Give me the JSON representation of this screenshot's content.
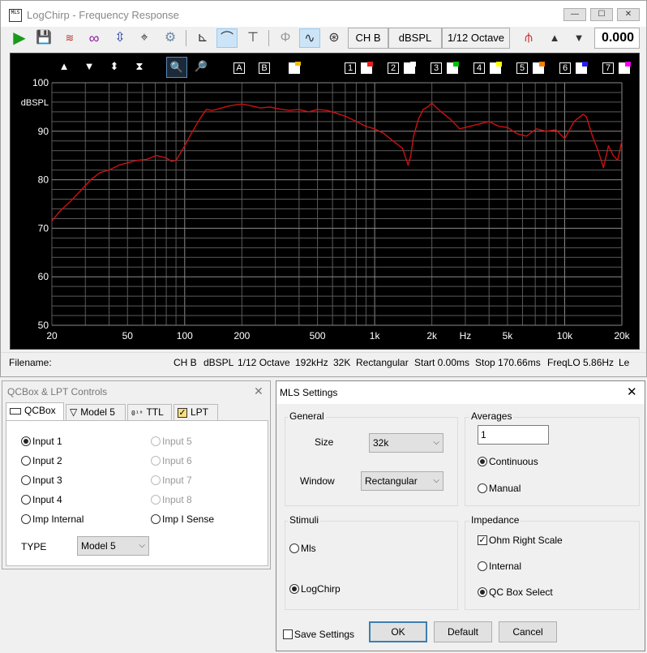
{
  "app": {
    "icon_text": "MLS",
    "title": "LogChirp - Frequency Response",
    "window_buttons": [
      "—",
      "☐",
      "✕"
    ]
  },
  "toolbar": {
    "channel": "CH B",
    "units": "dBSPL",
    "smoothing": "1/12 Octave",
    "gain": "0.000"
  },
  "chart_toolbar": {
    "a_label": "A",
    "b_label": "B",
    "channels": [
      "1",
      "2",
      "3",
      "4",
      "5",
      "6",
      "7"
    ],
    "channel_colors": [
      "#e82020",
      "#ffffff",
      "#00c000",
      "#ffff00",
      "#ff8000",
      "#2020ff",
      "#ff00ff"
    ]
  },
  "chart_data": {
    "type": "line",
    "ylabel": "dBSPL",
    "xscale": "log",
    "xlim": [
      20,
      20000
    ],
    "ylim": [
      50,
      100
    ],
    "yticks": [
      50,
      60,
      70,
      80,
      90,
      100
    ],
    "xtick_labels": [
      "20",
      "50",
      "100",
      "200",
      "500",
      "1k",
      "2k",
      "Hz",
      "5k",
      "10k",
      "20k"
    ],
    "grid": true,
    "series": [
      {
        "color": "#cc1111",
        "x": [
          20,
          22,
          25,
          28,
          32,
          36,
          40,
          45,
          50,
          56,
          63,
          71,
          80,
          85,
          90,
          95,
          100,
          110,
          120,
          130,
          140,
          150,
          170,
          190,
          200,
          220,
          250,
          280,
          315,
          355,
          400,
          450,
          500,
          560,
          630,
          710,
          800,
          900,
          1000,
          1120,
          1250,
          1400,
          1500,
          1550,
          1600,
          1700,
          1800,
          1900,
          2000,
          2100,
          2240,
          2500,
          2800,
          3150,
          3550,
          4000,
          4500,
          5000,
          5600,
          6300,
          7100,
          8000,
          9000,
          10000,
          11200,
          12500,
          13000,
          14000,
          15000,
          16000,
          17000,
          18000,
          19000,
          20000
        ],
        "y": [
          71.5,
          73.5,
          75.5,
          77.5,
          80.0,
          81.5,
          82.0,
          83.0,
          83.5,
          84.0,
          84.2,
          85.0,
          84.5,
          83.8,
          84.0,
          85.5,
          87.0,
          90.0,
          92.5,
          94.5,
          94.3,
          94.6,
          95.2,
          95.5,
          95.6,
          95.3,
          94.8,
          95.0,
          94.6,
          94.3,
          94.5,
          94.0,
          94.5,
          94.3,
          93.7,
          93.0,
          92.0,
          91.0,
          90.5,
          89.5,
          88.0,
          86.5,
          83.0,
          85.0,
          89.0,
          92.5,
          94.5,
          95.0,
          95.8,
          95.0,
          94.0,
          92.5,
          90.5,
          91.0,
          91.5,
          92.0,
          91.0,
          90.8,
          89.5,
          89.0,
          90.5,
          90.0,
          90.3,
          88.5,
          92.0,
          93.5,
          93.0,
          89.0,
          86.0,
          82.5,
          87.0,
          85.0,
          84.0,
          88.0
        ]
      }
    ]
  },
  "status_bar": {
    "filename_label": "Filename:",
    "fields": [
      "CH B",
      "dBSPL",
      "1/12 Octave",
      "192kHz",
      "32K",
      "Rectangular",
      "Start 0.00ms",
      "Stop 170.66ms",
      "FreqLO 5.86Hz",
      "Le"
    ]
  },
  "qcbox": {
    "title": "QCBox & LPT Controls",
    "close": "✕",
    "tabs": [
      "QCBox",
      "Model 5",
      "TTL",
      "LPT"
    ],
    "inputs_left": [
      "Input 1",
      "Input 2",
      "Input 3",
      "Input 4",
      "Imp Internal"
    ],
    "inputs_right": [
      "Input 5",
      "Input 6",
      "Input 7",
      "Input 8",
      "Imp I Sense"
    ],
    "type_label": "TYPE",
    "type_value": "Model 5"
  },
  "mls": {
    "title": "MLS Settings",
    "close": "✕",
    "general": {
      "title": "General",
      "size_label": "Size",
      "size_value": "32k",
      "window_label": "Window",
      "window_value": "Rectangular"
    },
    "averages": {
      "title": "Averages",
      "value": "1",
      "continuous": "Continuous",
      "manual": "Manual"
    },
    "stimuli": {
      "title": "Stimuli",
      "mls": "Mls",
      "logchirp": "LogChirp"
    },
    "impedance": {
      "title": "Impedance",
      "ohm_right_scale": "Ohm Right Scale",
      "internal": "Internal",
      "qc_box_select": "QC Box Select"
    },
    "save_settings": "Save Settings",
    "ok": "OK",
    "default": "Default",
    "cancel": "Cancel"
  }
}
